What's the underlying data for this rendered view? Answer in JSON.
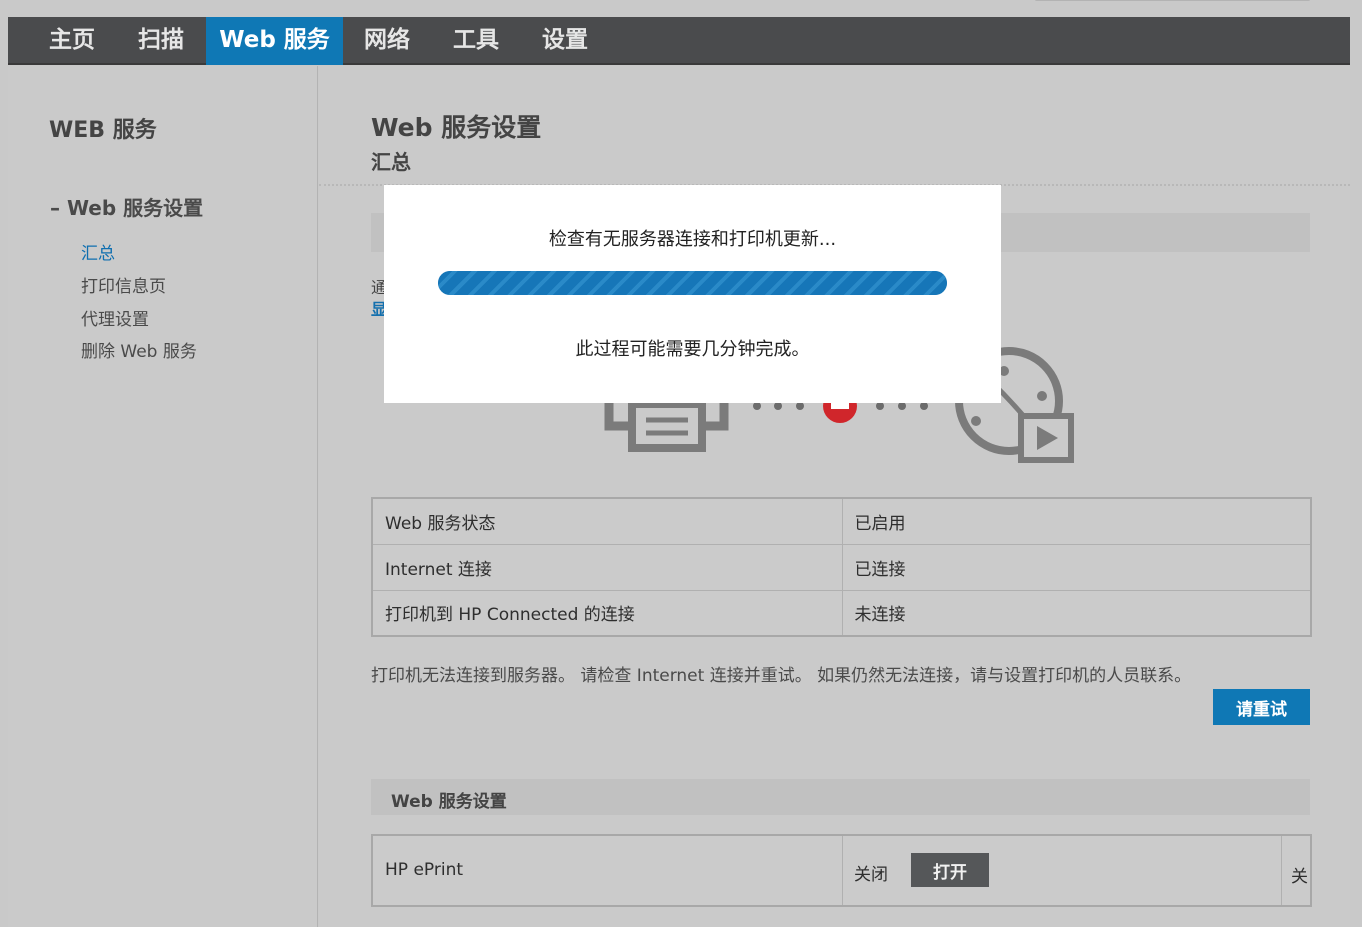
{
  "nav": {
    "tabs": [
      {
        "label": "主页"
      },
      {
        "label": "扫描"
      },
      {
        "label": "Web 服务",
        "active": true
      },
      {
        "label": "网络"
      },
      {
        "label": "工具"
      },
      {
        "label": "设置"
      }
    ]
  },
  "sidebar": {
    "title": "WEB 服务",
    "group": "– Web 服务设置",
    "items": [
      {
        "label": "汇总",
        "active": true
      },
      {
        "label": "打印信息页"
      },
      {
        "label": "代理设置"
      },
      {
        "label": "删除 Web 服务"
      }
    ]
  },
  "main": {
    "title": "Web 服务设置",
    "subtitle": "汇总",
    "intro_partial": "通",
    "intro_link_partial": "显",
    "status_rows": [
      {
        "label": "Web 服务状态",
        "value": "已启用"
      },
      {
        "label": "Internet 连接",
        "value": "已连接"
      },
      {
        "label": "打印机到 HP Connected 的连接",
        "value": "未连接"
      }
    ],
    "warning": "打印机无法连接到服务器。 请检查 Internet 连接并重试。 如果仍然无法连接，请与设置打印机的人员联系。",
    "retry_label": "请重试",
    "section_title": "Web 服务设置",
    "eprint": {
      "label": "HP ePrint",
      "state": "关闭",
      "toggle_label": "打开",
      "edge_partial": "关"
    }
  },
  "modal": {
    "message": "检查有无服务器连接和打印机更新...",
    "progress_percent": 100,
    "note": "此过程可能需要几分钟完成。"
  },
  "colors": {
    "accent": "#0f78b5",
    "navbar": "#4a4b4d",
    "error": "#d0262b"
  }
}
